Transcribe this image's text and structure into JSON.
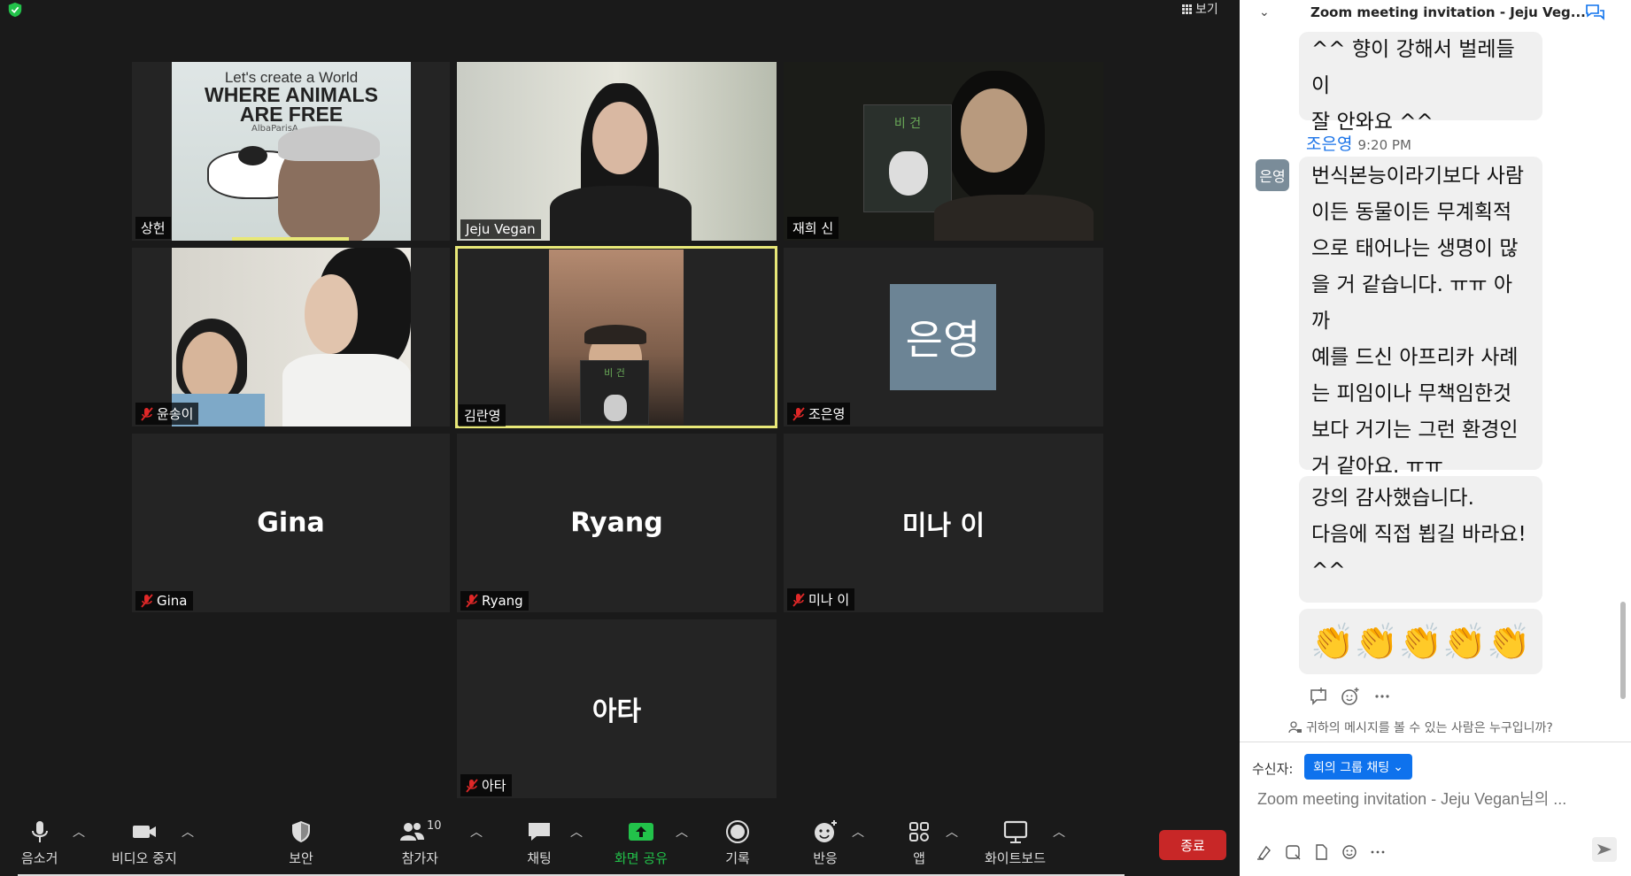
{
  "view_label": "보기",
  "participants": [
    {
      "name": "상헌",
      "type": "video",
      "muted": false,
      "poster": {
        "line1": "Let's create a World",
        "line2": "WHERE ANIMALS",
        "line3": "ARE FREE",
        "line4": "AlbaParisA"
      }
    },
    {
      "name": "Jeju Vegan",
      "type": "video",
      "muted": false
    },
    {
      "name": "재희 신",
      "type": "video",
      "muted": false,
      "sign_text": "비 건"
    },
    {
      "name": "윤송이",
      "type": "video",
      "muted": true
    },
    {
      "name": "김란영",
      "type": "video",
      "muted": false,
      "active_speaker": true,
      "sign_text": "비 건"
    },
    {
      "name": "조은영",
      "type": "avatar",
      "muted": true,
      "avatar_text": "은영"
    },
    {
      "name": "Gina",
      "type": "name",
      "muted": true,
      "display": "Gina"
    },
    {
      "name": "Ryang",
      "type": "name",
      "muted": true,
      "display": "Ryang"
    },
    {
      "name": "미나 이",
      "type": "name",
      "muted": true,
      "display": "미나 이"
    },
    {
      "name": "아타",
      "type": "name",
      "muted": true,
      "display": "아타"
    }
  ],
  "toolbar": {
    "mute": "음소거",
    "stop_video": "비디오 중지",
    "security": "보안",
    "participants": "참가자",
    "participants_count": "10",
    "chat": "채팅",
    "share_screen": "화면 공유",
    "record": "기록",
    "reactions": "반응",
    "apps": "앱",
    "whiteboard": "화이트보드",
    "end": "종료"
  },
  "colors": {
    "share_green": "#22c24a",
    "end_red": "#c82727",
    "active_border": "#e8e878",
    "link_blue": "#1a73e8",
    "select_blue": "#0e72ed"
  },
  "chat": {
    "title": "Zoom meeting invitation - Jeju Veg...",
    "messages": [
      {
        "id": "m1",
        "lines": [
          "^^ 향이 강해서 벌레들이",
          "잘 안와요 ^^"
        ]
      },
      {
        "id": "m2",
        "sender": "조은영",
        "time": "9:20 PM",
        "avatar": "은영",
        "lines": [
          "번식본능이라기보다 사람",
          "이든 동물이든 무계획적",
          "으로 태어나는 생명이 많",
          "을 거 같습니다. ㅠㅠ 아까",
          "예를 드신 아프리카 사례",
          "는 피임이나 무책임한것",
          "보다 거기는 그런 환경인",
          "거 같아요. ㅠㅠ"
        ]
      },
      {
        "id": "m3",
        "lines": [
          "강의 감사했습니다.",
          "다음에 직접 뵙길 바라요!",
          "^^"
        ]
      }
    ],
    "emoji_message": "👏👏👏👏👏",
    "visibility_text": "귀하의 메시지를 볼 수 있는 사람은 누구입니까?",
    "to_label": "수신자:",
    "to_selected": "회의 그룹 채팅",
    "input_placeholder": "Zoom meeting invitation - Jeju Vegan님의 ..."
  }
}
